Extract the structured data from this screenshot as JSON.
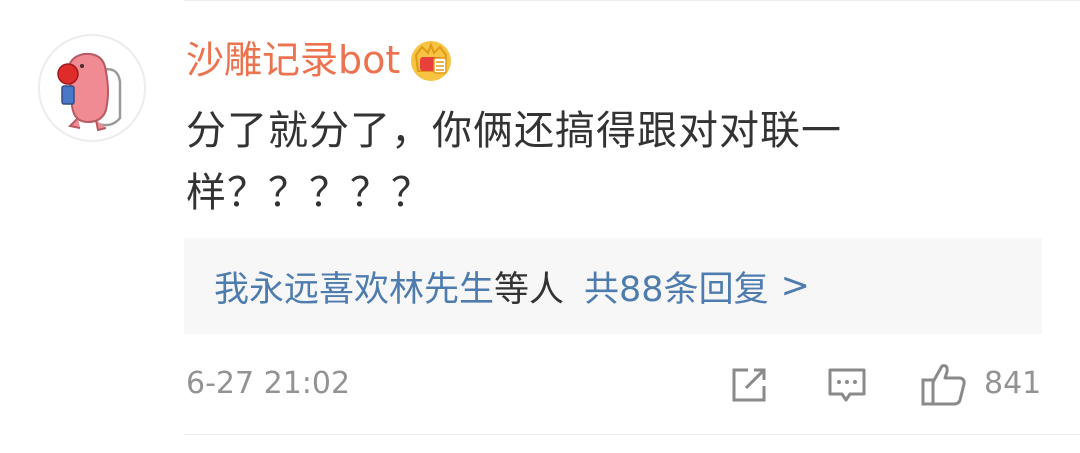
{
  "comment": {
    "username": "沙雕记录bot",
    "badge_icon": "crown-vip-icon",
    "text_lines": [
      "分了就分了，你俩还搞得跟对对联一",
      "样？？？？？"
    ],
    "replies": {
      "users": "我永远喜欢林先生",
      "mid": "等人",
      "count": "共88条回复",
      "arrow": ">"
    },
    "timestamp": "6-27 21:02",
    "actions": {
      "share_icon": "share-icon",
      "comment_icon": "comment-icon",
      "like_icon": "thumbs-up-icon",
      "like_count": "841"
    }
  },
  "colors": {
    "username": "#eb7350",
    "link": "#4f7cae",
    "text": "#333333",
    "meta": "#939393",
    "reply_bg": "#f7f7f7"
  }
}
